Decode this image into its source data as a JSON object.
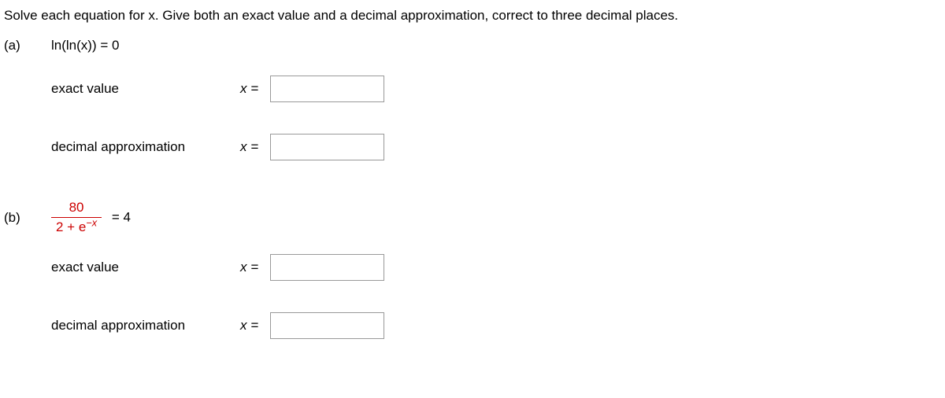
{
  "instruction": "Solve each equation for x. Give both an exact value and a decimal approximation, correct to three decimal places.",
  "part_a": {
    "label": "(a)",
    "equation": "ln(ln(x)) = 0",
    "exact_label": "exact value",
    "decimal_label": "decimal approximation",
    "xeq": "x ="
  },
  "part_b": {
    "label": "(b)",
    "fraction_num": "80",
    "fraction_den_pre": "2 + e",
    "fraction_den_exp": "−x",
    "eq_rhs": "= 4",
    "exact_label": "exact value",
    "decimal_label": "decimal approximation",
    "xeq": "x ="
  }
}
